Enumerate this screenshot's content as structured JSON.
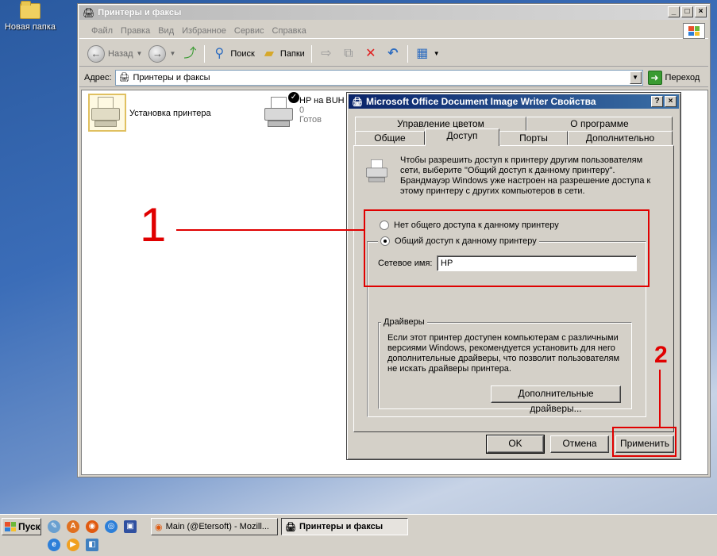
{
  "desktop": {
    "icon_label": "Новая папка"
  },
  "explorer": {
    "title": "Принтеры и факсы",
    "menu": [
      "Файл",
      "Правка",
      "Вид",
      "Избранное",
      "Сервис",
      "Справка"
    ],
    "toolbar": {
      "back": "Назад",
      "search": "Поиск",
      "folders": "Папки"
    },
    "address_label": "Адрес:",
    "address_value": "Принтеры и факсы",
    "go_label": "Переход",
    "items": {
      "add_printer": "Установка принтера",
      "hp_name": "HP на BUH",
      "hp_count": "0",
      "hp_status": "Готов"
    }
  },
  "dialog": {
    "title": "Microsoft Office Document Image Writer Свойства",
    "tabs_row1": [
      "Управление цветом",
      "О программе"
    ],
    "tabs_row2": [
      "Общие",
      "Доступ",
      "Порты",
      "Дополнительно"
    ],
    "active_tab": "Доступ",
    "info_text": "Чтобы разрешить доступ к принтеру другим пользователям сети, выберите \"Общий доступ к данному принтеру\". Брандмауэр Windows уже настроен на разрешение доступа к этому принтеру с других компьютеров в сети.",
    "radio_no_share": "Нет общего доступа к данному принтеру",
    "radio_share": "Общий доступ к данному принтеру",
    "share_name_label": "Сетевое имя:",
    "share_name_value": "HP",
    "drivers_legend": "Драйверы",
    "drivers_text": "Если этот принтер доступен компьютерам с различными версиями Windows, рекомендуется установить для него дополнительные драйверы, что позволит пользователям не искать драйверы принтера.",
    "drivers_button": "Дополнительные драйверы...",
    "ok": "OK",
    "cancel": "Отмена",
    "apply": "Применить"
  },
  "annotations": {
    "one": "1",
    "two": "2"
  },
  "taskbar": {
    "start": "Пуск",
    "tasks": [
      "Main (@Etersoft) - Mozill...",
      "Принтеры и факсы"
    ]
  },
  "colors": {
    "annotation_red": "#e00000",
    "dialog_title": "#0a246a",
    "panel": "#d4d0c8"
  }
}
